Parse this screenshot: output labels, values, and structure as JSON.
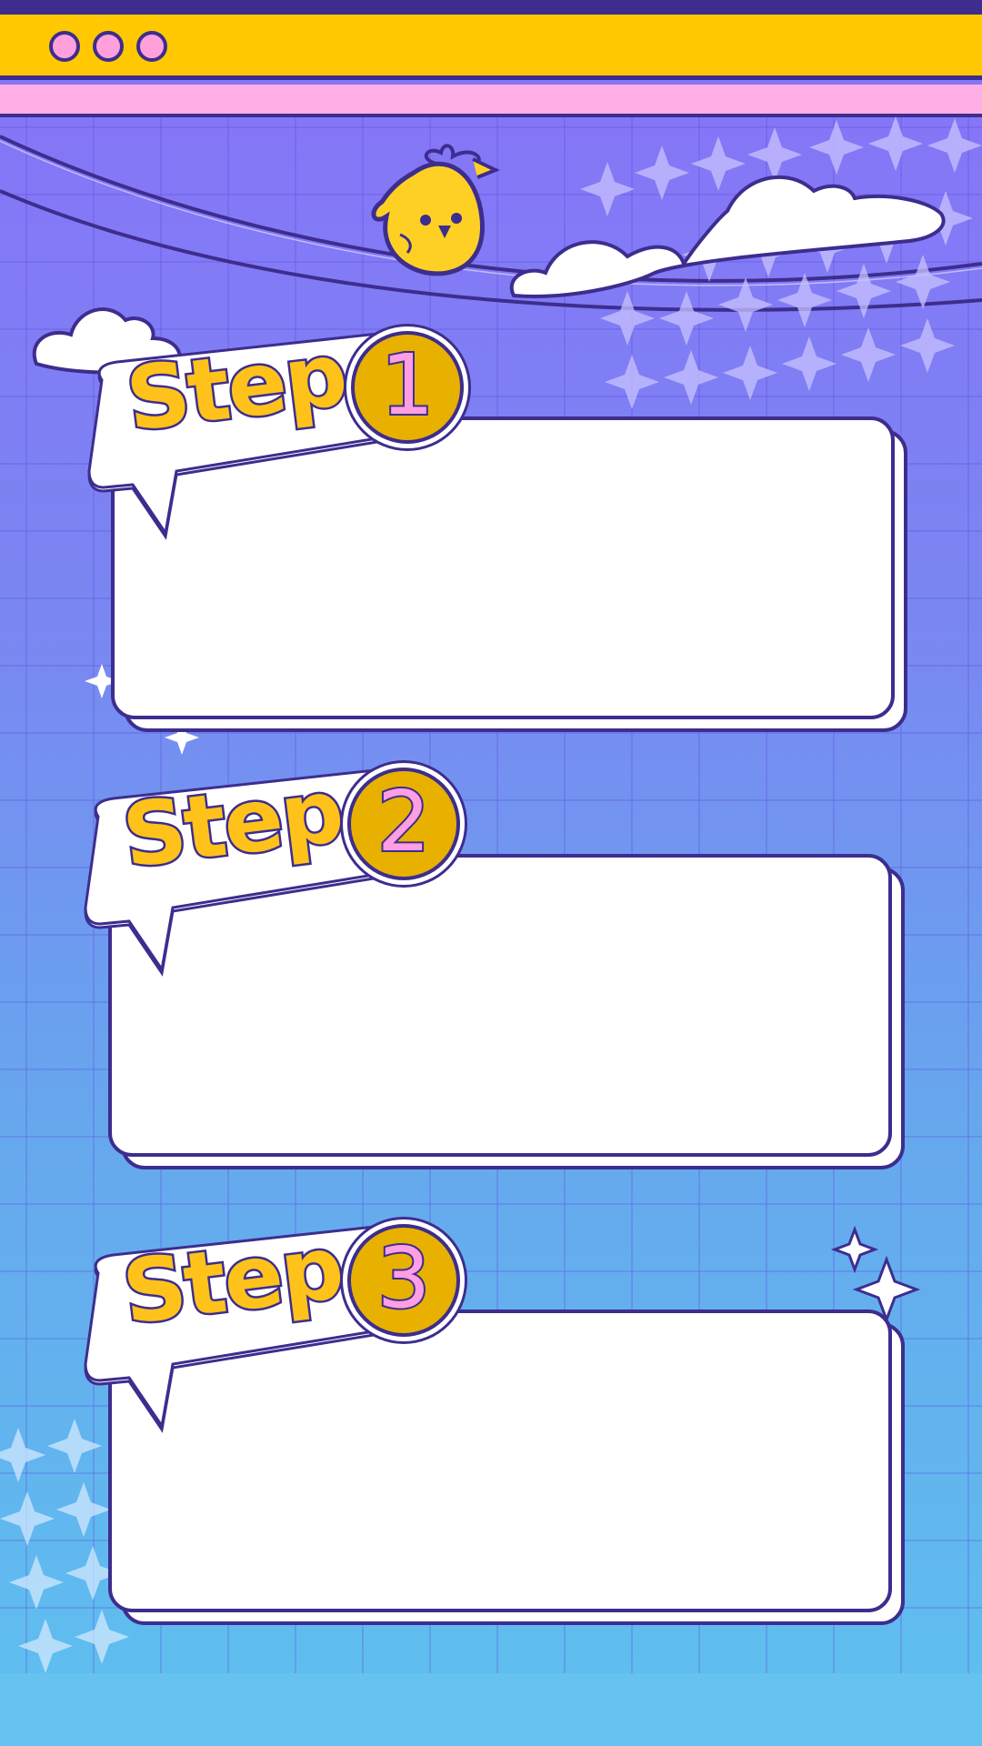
{
  "window": {
    "controls": [
      "dot",
      "dot",
      "dot"
    ]
  },
  "colors": {
    "accent_yellow": "#ffc800",
    "outline_purple": "#3d2d8e",
    "pink": "#ffaee6",
    "card_white": "#ffffff"
  },
  "steps": [
    {
      "label": "Step",
      "number": "1"
    },
    {
      "label": "Step",
      "number": "2"
    },
    {
      "label": "Step",
      "number": "3"
    }
  ],
  "decorations": [
    "chick-icon",
    "cloud-icon",
    "sparkle-icon"
  ]
}
